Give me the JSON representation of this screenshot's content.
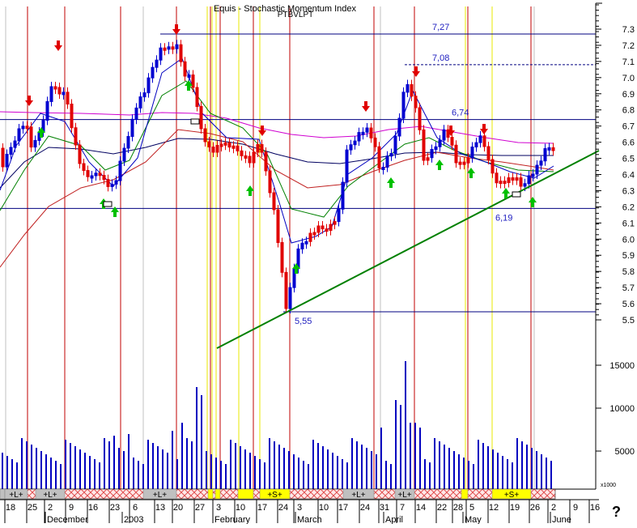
{
  "header": {
    "title": "Equis - Stochastic Momentum Index",
    "ticker": "PTBVLPT"
  },
  "chart_data": {
    "type": "candlestick",
    "price_axis": {
      "min": 5.5,
      "max": 7.3,
      "ticks": [
        "7.3",
        "7.2",
        "7.1",
        "7.0",
        "6.9",
        "6.8",
        "6.7",
        "6.6",
        "6.5",
        "6.4",
        "6.3",
        "6.2",
        "6.1",
        "6.0",
        "5.9",
        "5.8",
        "5.7",
        "5.6",
        "5.5"
      ]
    },
    "volume_axis": {
      "ticks": [
        "15000",
        "10000",
        "5000"
      ],
      "bottom_label": "x1000"
    },
    "levels": [
      {
        "label": "7,27",
        "value": 7.27
      },
      {
        "label": "7,08",
        "value": 7.08
      },
      {
        "label": "6,74",
        "value": 6.74
      },
      {
        "label": "6,19",
        "value": 6.19
      },
      {
        "label": "5,55",
        "value": 5.55
      }
    ],
    "x_day_labels": [
      "18",
      "25",
      "2",
      "9",
      "16",
      "23",
      "6",
      "13",
      "20",
      "27",
      "3",
      "10",
      "17",
      "24",
      "3",
      "10",
      "17",
      "24",
      "31",
      "7",
      "14",
      "22",
      "28",
      "5",
      "12",
      "19",
      "26",
      "2",
      "9",
      "16"
    ],
    "month_labels": [
      "December",
      "2003",
      "February",
      "March",
      "April",
      "May",
      "June"
    ],
    "signal_bar": [
      "+L+",
      "+L+",
      "+L+",
      "+L+",
      "+L+",
      "+S+",
      "+S+"
    ]
  }
}
